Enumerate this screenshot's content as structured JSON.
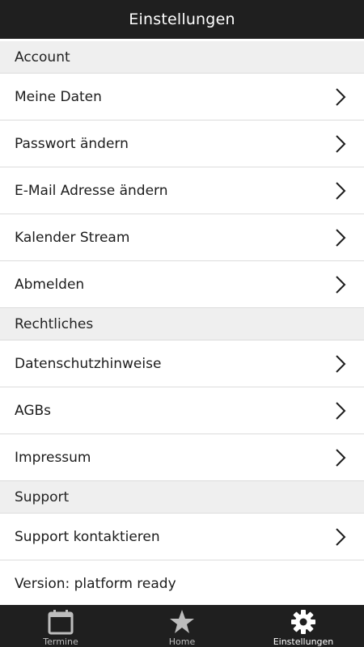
{
  "header": {
    "title": "Einstellungen"
  },
  "sections": [
    {
      "title": "Account",
      "items": [
        {
          "label": "Meine Daten"
        },
        {
          "label": "Passwort ändern"
        },
        {
          "label": "E-Mail Adresse ändern"
        },
        {
          "label": "Kalender Stream"
        },
        {
          "label": "Abmelden"
        }
      ]
    },
    {
      "title": "Rechtliches",
      "items": [
        {
          "label": "Datenschutzhinweise"
        },
        {
          "label": "AGBs"
        },
        {
          "label": "Impressum"
        }
      ]
    },
    {
      "title": "Support",
      "items": [
        {
          "label": "Support kontaktieren"
        }
      ]
    }
  ],
  "version_text": "Version: platform ready",
  "tabbar": {
    "tabs": [
      {
        "label": "Termine",
        "icon": "calendar-icon",
        "active": false
      },
      {
        "label": "Home",
        "icon": "star-icon",
        "active": false
      },
      {
        "label": "Einstellungen",
        "icon": "gear-icon",
        "active": true
      }
    ]
  },
  "colors": {
    "header_bg": "#1f1f1f",
    "section_bg": "#efefef",
    "divider": "#dcdcdc",
    "tab_active": "#ffffff",
    "tab_inactive": "#bdbdbd"
  }
}
